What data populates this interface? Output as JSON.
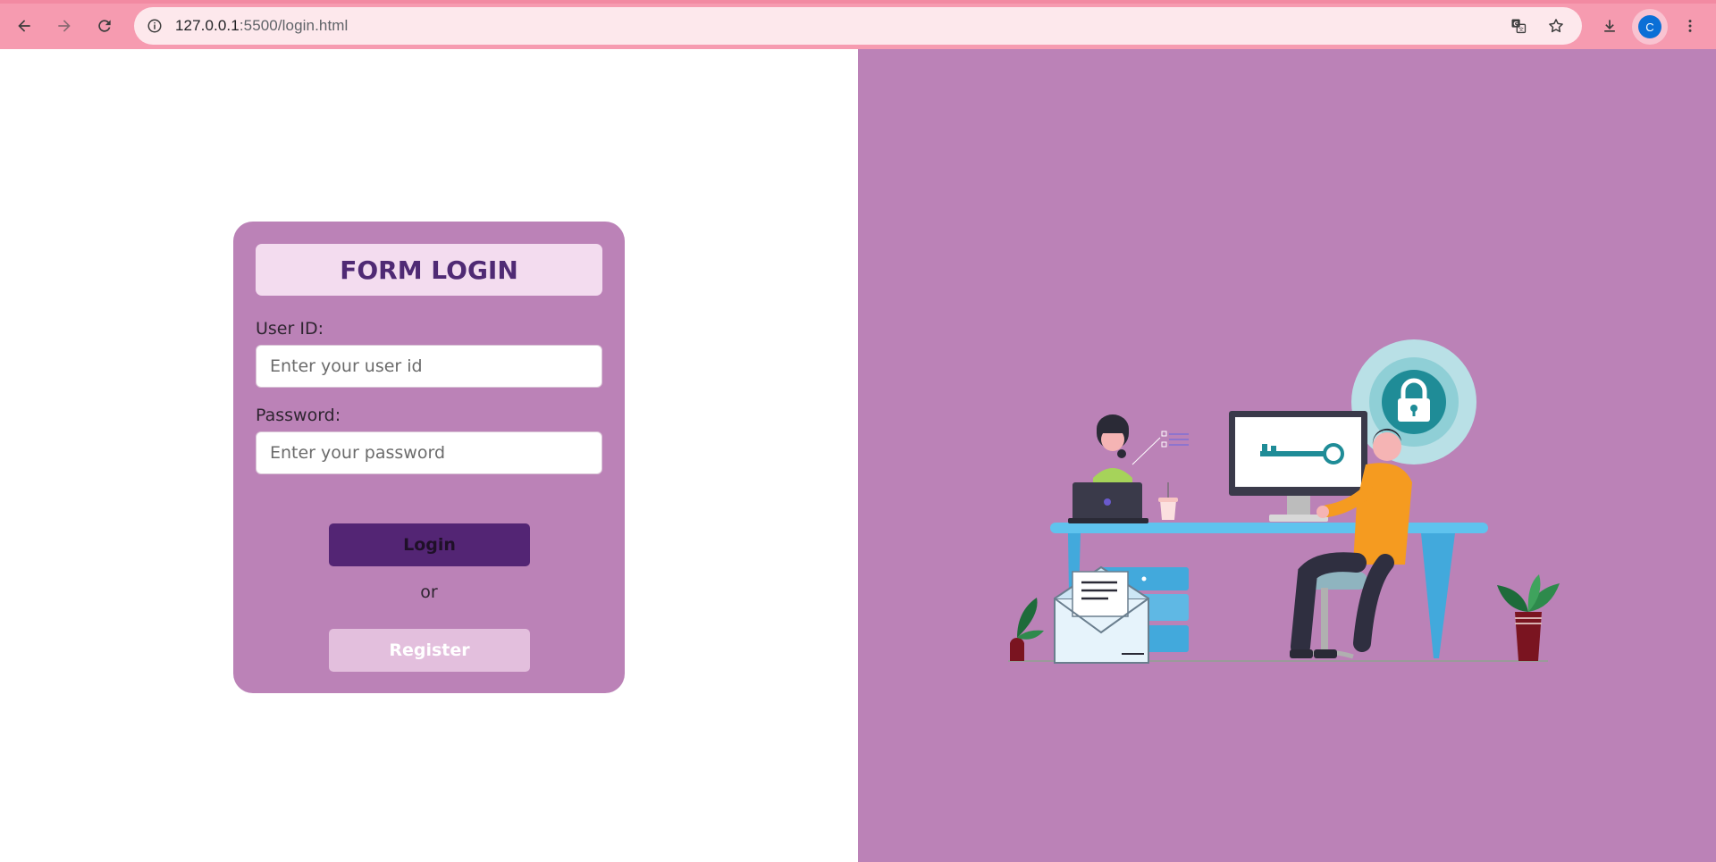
{
  "browser": {
    "url_host": "127.0.0.1",
    "url_path": ":5500/login.html",
    "profile_initial": "C",
    "icons": {
      "back": "back-arrow-icon",
      "forward": "forward-arrow-icon",
      "reload": "reload-icon",
      "site_info": "info-icon",
      "translate": "translate-icon",
      "bookmark": "star-icon",
      "downloads": "download-icon",
      "menu": "kebab-menu-icon"
    },
    "colors": {
      "chrome": "#f69bb0",
      "omnibox": "#fde8ec",
      "avatar": "#0b6fd6"
    }
  },
  "login_form": {
    "title": "FORM LOGIN",
    "user_id_label": "User ID:",
    "user_id_placeholder": "Enter your user id",
    "user_id_value": "",
    "password_label": "Password:",
    "password_placeholder": "Enter your password",
    "password_value": "",
    "login_button": "Login",
    "or_text": "or",
    "register_button": "Register"
  },
  "colors": {
    "panel": "#bb82b7",
    "title_bg": "#f3dcef",
    "title_text": "#4f2a74",
    "login_button": "#532574",
    "register_button": "#e3bfdd"
  }
}
